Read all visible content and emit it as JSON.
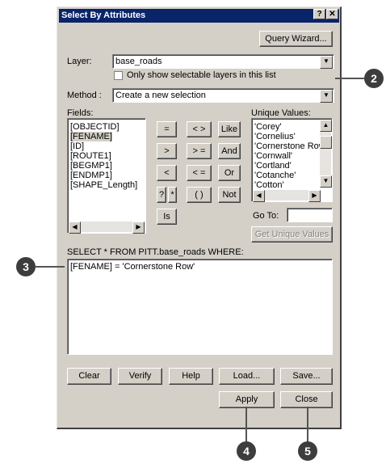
{
  "window": {
    "title": "Select By Attributes",
    "help_btn": "?",
    "close_btn": "✕"
  },
  "toolbar": {
    "query_wizard": "Query Wizard..."
  },
  "layer": {
    "label": "Layer:",
    "value": "base_roads",
    "only_selectable": "Only show selectable layers in this list"
  },
  "method": {
    "label": "Method :",
    "value": "Create a new selection"
  },
  "fields": {
    "label": "Fields:",
    "items": [
      "[OBJECTID]",
      "[FENAME]",
      "[ID]",
      "[ROUTE1]",
      "[BEGMP1]",
      "[ENDMP1]",
      "[SHAPE_Length]"
    ],
    "selected_index": 1
  },
  "operators": {
    "eq": "=",
    "ne": "< >",
    "like": "Like",
    "gt": ">",
    "ge": "> =",
    "and": "And",
    "lt": "<",
    "le": "< =",
    "or": "Or",
    "q": "?",
    "star": "*",
    "paren": "( )",
    "not": "Not",
    "is": "Is"
  },
  "unique_values": {
    "label": "Unique Values:",
    "items": [
      "'Corey'",
      "'Cornelius'",
      "'Cornerstone Row'",
      "'Cornwall'",
      "'Cortland'",
      "'Cotanche'",
      "'Cotton'"
    ]
  },
  "goto": {
    "label": "Go To:",
    "value": ""
  },
  "get_unique_values": "Get Unique Values",
  "sql": {
    "label": "SELECT * FROM PITT.base_roads WHERE:",
    "expression": "[FENAME] = 'Cornerstone Row'"
  },
  "buttons": {
    "clear": "Clear",
    "verify": "Verify",
    "help": "Help",
    "load": "Load...",
    "save": "Save...",
    "apply": "Apply",
    "close": "Close"
  },
  "callouts": {
    "c2": "2",
    "c3": "3",
    "c4": "4",
    "c5": "5"
  },
  "colors": {
    "title_bar": "#0a246a",
    "dialog_face": "#d4d0c8",
    "callout": "#3d3d3d"
  }
}
